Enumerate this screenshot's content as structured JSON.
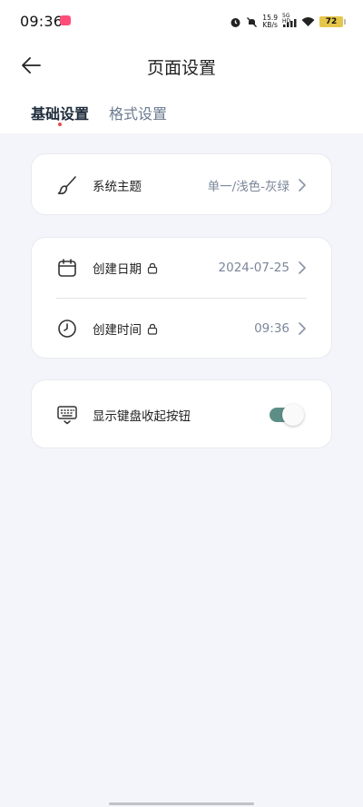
{
  "status_bar": {
    "time": "09:36",
    "net_speed_value": "15.9",
    "net_speed_unit": "KB/s",
    "signal_label": "5G HD",
    "battery_level": "72"
  },
  "header": {
    "title": "页面设置"
  },
  "tabs": [
    {
      "label": "基础设置",
      "active": true
    },
    {
      "label": "格式设置",
      "active": false
    }
  ],
  "settings": {
    "theme": {
      "label": "系统主题",
      "value": "单一/浅色-灰绿",
      "icon": "brush-icon"
    },
    "created_date": {
      "label": "创建日期",
      "value": "2024-07-25",
      "icon": "calendar-icon",
      "locked": true
    },
    "created_time": {
      "label": "创建时间",
      "value": "09:36",
      "icon": "clock-icon",
      "locked": true
    },
    "keyboard_button": {
      "label": "显示键盘收起按钮",
      "enabled": true,
      "icon": "keyboard-icon"
    }
  },
  "colors": {
    "accent": "#5d8e86",
    "tab_indicator": "#e94a4a",
    "background": "#f4f5fa"
  }
}
